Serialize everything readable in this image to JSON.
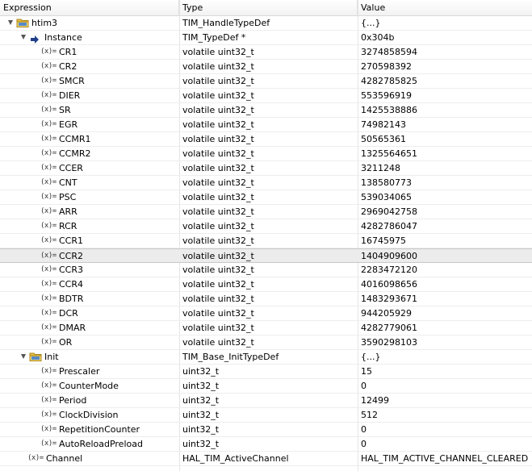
{
  "header": {
    "expression": "Expression",
    "type": "Type",
    "value": "Value"
  },
  "icon_prefix": "(x)=",
  "htim3": {
    "name": "htim3",
    "type": "TIM_HandleTypeDef",
    "value": "{...}"
  },
  "instance": {
    "name": "Instance",
    "type": "TIM_TypeDef *",
    "value": "0x304b"
  },
  "registers": [
    {
      "name": "CR1",
      "type": "volatile uint32_t",
      "value": "3274858594"
    },
    {
      "name": "CR2",
      "type": "volatile uint32_t",
      "value": "270598392"
    },
    {
      "name": "SMCR",
      "type": "volatile uint32_t",
      "value": "4282785825"
    },
    {
      "name": "DIER",
      "type": "volatile uint32_t",
      "value": "553596919"
    },
    {
      "name": "SR",
      "type": "volatile uint32_t",
      "value": "1425538886"
    },
    {
      "name": "EGR",
      "type": "volatile uint32_t",
      "value": "74982143"
    },
    {
      "name": "CCMR1",
      "type": "volatile uint32_t",
      "value": "50565361"
    },
    {
      "name": "CCMR2",
      "type": "volatile uint32_t",
      "value": "1325564651"
    },
    {
      "name": "CCER",
      "type": "volatile uint32_t",
      "value": "3211248"
    },
    {
      "name": "CNT",
      "type": "volatile uint32_t",
      "value": "138580773"
    },
    {
      "name": "PSC",
      "type": "volatile uint32_t",
      "value": "539034065"
    },
    {
      "name": "ARR",
      "type": "volatile uint32_t",
      "value": "2969042758"
    },
    {
      "name": "RCR",
      "type": "volatile uint32_t",
      "value": "4282786047"
    },
    {
      "name": "CCR1",
      "type": "volatile uint32_t",
      "value": "16745975"
    },
    {
      "name": "CCR2",
      "type": "volatile uint32_t",
      "value": "1404909600"
    },
    {
      "name": "CCR3",
      "type": "volatile uint32_t",
      "value": "2283472120"
    },
    {
      "name": "CCR4",
      "type": "volatile uint32_t",
      "value": "4016098656"
    },
    {
      "name": "BDTR",
      "type": "volatile uint32_t",
      "value": "1483293671"
    },
    {
      "name": "DCR",
      "type": "volatile uint32_t",
      "value": "944205929"
    },
    {
      "name": "DMAR",
      "type": "volatile uint32_t",
      "value": "4282779061"
    },
    {
      "name": "OR",
      "type": "volatile uint32_t",
      "value": "3590298103"
    }
  ],
  "init": {
    "name": "Init",
    "type": "TIM_Base_InitTypeDef",
    "value": "{...}"
  },
  "init_fields": [
    {
      "name": "Prescaler",
      "type": "uint32_t",
      "value": "15"
    },
    {
      "name": "CounterMode",
      "type": "uint32_t",
      "value": "0"
    },
    {
      "name": "Period",
      "type": "uint32_t",
      "value": "12499"
    },
    {
      "name": "ClockDivision",
      "type": "uint32_t",
      "value": "512"
    },
    {
      "name": "RepetitionCounter",
      "type": "uint32_t",
      "value": "0"
    },
    {
      "name": "AutoReloadPreload",
      "type": "uint32_t",
      "value": "0"
    }
  ],
  "channel": {
    "name": "Channel",
    "type": "HAL_TIM_ActiveChannel",
    "value": "HAL_TIM_ACTIVE_CHANNEL_CLEARED"
  }
}
